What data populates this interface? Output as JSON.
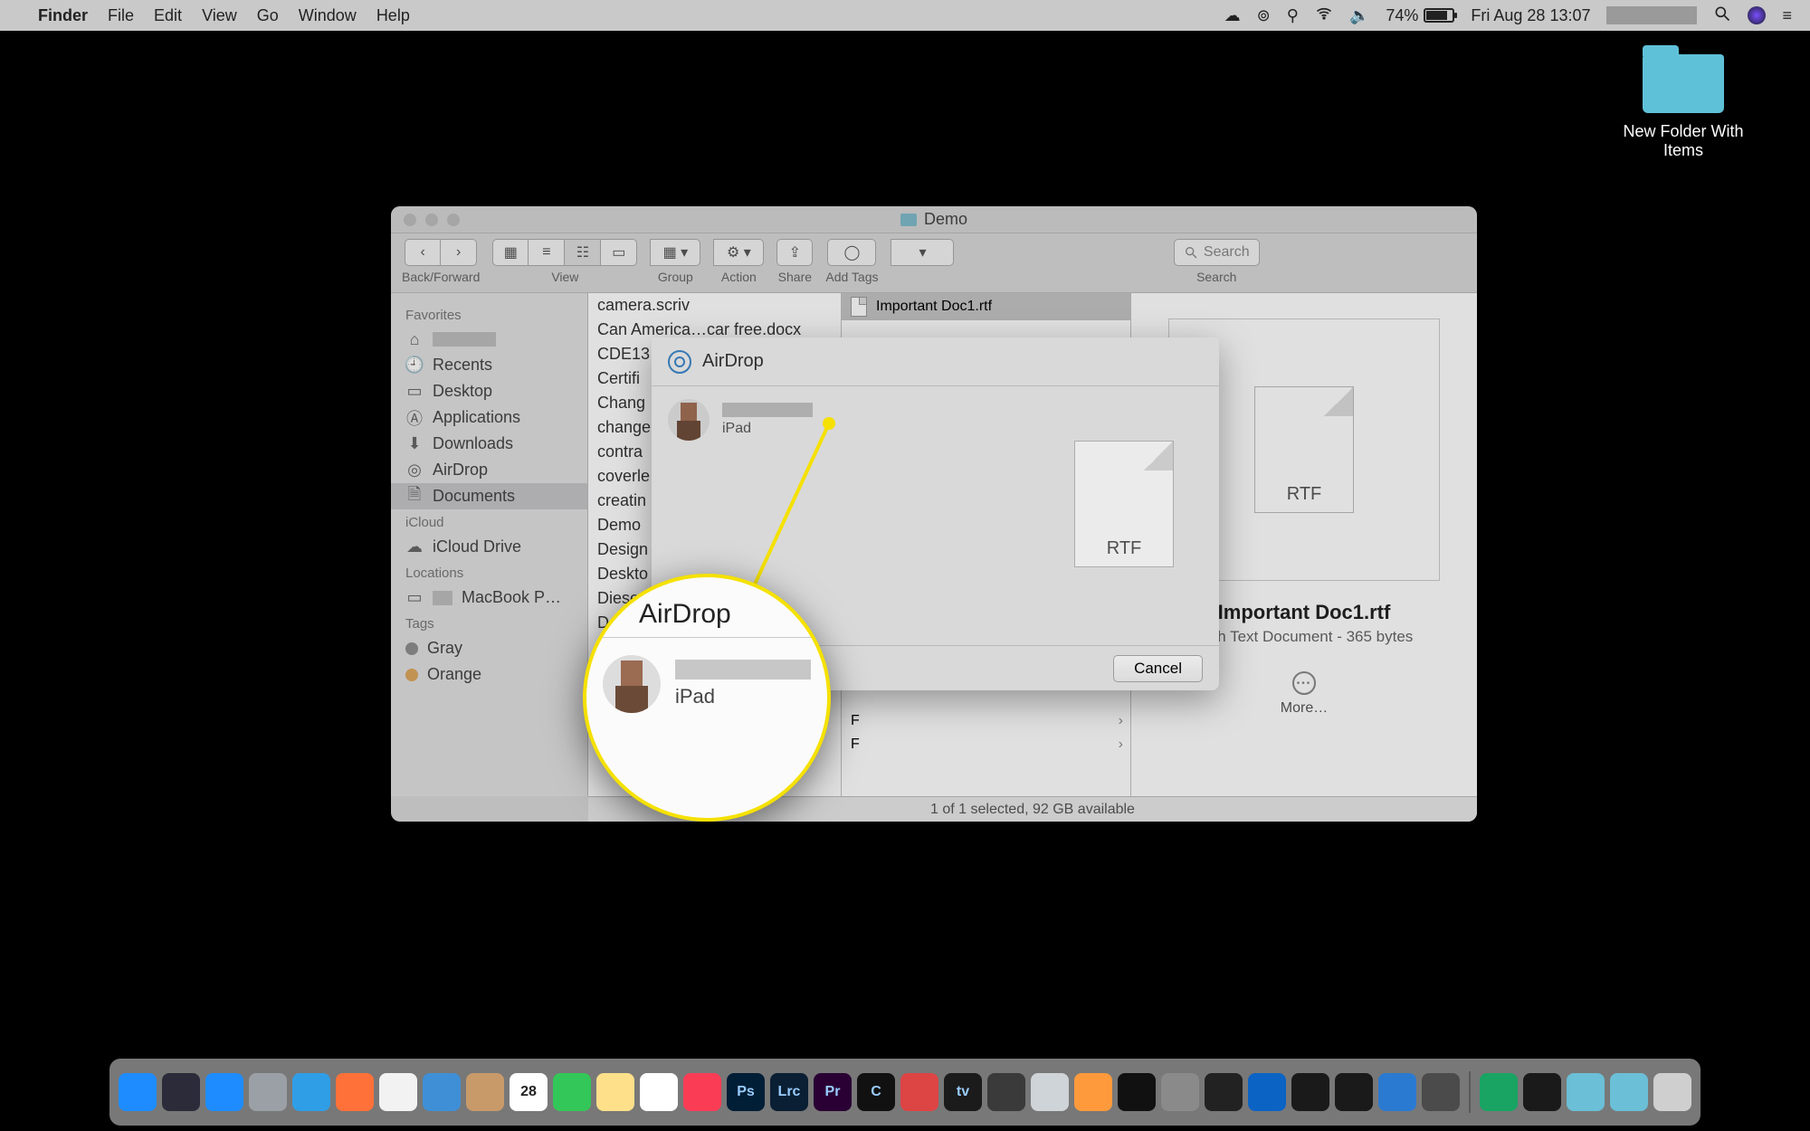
{
  "menubar": {
    "app_name": "Finder",
    "menus": [
      "File",
      "Edit",
      "View",
      "Go",
      "Window",
      "Help"
    ],
    "battery_pct": "74%",
    "clock": "Fri Aug 28  13:07"
  },
  "desktop_folder": {
    "label": "New Folder With Items"
  },
  "finder": {
    "title": "Demo",
    "toolbar": {
      "back_forward": "Back/Forward",
      "view": "View",
      "group": "Group",
      "action": "Action",
      "share": "Share",
      "tags": "Add Tags",
      "search_placeholder": "Search",
      "search_label": "Search"
    },
    "sidebar": {
      "favorites_label": "Favorites",
      "favorites": [
        "",
        "Recents",
        "Desktop",
        "Applications",
        "Downloads",
        "AirDrop",
        "Documents"
      ],
      "icloud_label": "iCloud",
      "icloud": [
        "iCloud Drive"
      ],
      "locations_label": "Locations",
      "locations": [
        "MacBook P…"
      ],
      "tags_label": "Tags",
      "tags": [
        {
          "name": "Gray",
          "color": "#8e8e8e"
        },
        {
          "name": "Orange",
          "color": "#f0a33a"
        }
      ]
    },
    "col_files": [
      "camera.scriv",
      "Can America…car free.docx",
      "CDE13",
      "Certifi",
      "Chang",
      "change",
      "contra",
      "coverle",
      "creatin",
      "Demo",
      "Design",
      "Deskto",
      "Diese",
      "D"
    ],
    "col_mid": {
      "selected": "Important Doc1.rtf",
      "folders": [
        "F",
        "F"
      ]
    },
    "preview": {
      "doc_ext": "RTF",
      "name": "Important Doc1.rtf",
      "meta": "Rich Text Document - 365 bytes",
      "more": "More…"
    },
    "status": "1 of 1 selected, 92 GB available"
  },
  "sheet": {
    "title": "AirDrop",
    "device_sub": "iPad",
    "doc_ext": "RTF",
    "cancel": "Cancel"
  },
  "zoom": {
    "title": "AirDrop",
    "sub": "iPad"
  },
  "dock": {
    "apps": [
      {
        "n": "finder",
        "c": "#1e8cff"
      },
      {
        "n": "siri",
        "c": "#2b2b3a"
      },
      {
        "n": "appstore",
        "c": "#1e8cff"
      },
      {
        "n": "launchpad",
        "c": "#9aa0a6"
      },
      {
        "n": "safari",
        "c": "#2f9ee6"
      },
      {
        "n": "firefox",
        "c": "#ff7139"
      },
      {
        "n": "chrome",
        "c": "#f2f2f2"
      },
      {
        "n": "mail",
        "c": "#3f8fd6"
      },
      {
        "n": "contacts",
        "c": "#c89a6a"
      },
      {
        "n": "calendar",
        "c": "#ffffff",
        "t": "28",
        "tc": "#222"
      },
      {
        "n": "messages",
        "c": "#33c759"
      },
      {
        "n": "notes",
        "c": "#ffe08a"
      },
      {
        "n": "reminders",
        "c": "#ffffff"
      },
      {
        "n": "music",
        "c": "#fa3c55"
      },
      {
        "n": "photoshop",
        "c": "#001e36",
        "t": "Ps"
      },
      {
        "n": "lightroom",
        "c": "#0a1f33",
        "t": "Lrc"
      },
      {
        "n": "premiere",
        "c": "#2a0034",
        "t": "Pr"
      },
      {
        "n": "capture",
        "c": "#111",
        "t": "C"
      },
      {
        "n": "app1",
        "c": "#d44"
      },
      {
        "n": "appletv",
        "c": "#1b1b1b",
        "t": "tv"
      },
      {
        "n": "quicktime",
        "c": "#3a3a3a"
      },
      {
        "n": "preview",
        "c": "#cfd4d8"
      },
      {
        "n": "pages",
        "c": "#ff9a3c"
      },
      {
        "n": "terminal",
        "c": "#111"
      },
      {
        "n": "systemprefs",
        "c": "#8a8a8a"
      },
      {
        "n": "app2",
        "c": "#222"
      },
      {
        "n": "onedrive",
        "c": "#0b63c4"
      },
      {
        "n": "nikon1",
        "c": "#1a1a1a"
      },
      {
        "n": "nikon2",
        "c": "#1a1a1a"
      },
      {
        "n": "vscode",
        "c": "#2b7ad1"
      },
      {
        "n": "sublime",
        "c": "#4b4b4b"
      }
    ],
    "right": [
      {
        "n": "app3",
        "c": "#19a463"
      },
      {
        "n": "1password",
        "c": "#1a1a1a"
      },
      {
        "n": "downloads",
        "c": "#6bbfd6"
      },
      {
        "n": "folder",
        "c": "#6bbfd6"
      },
      {
        "n": "trash",
        "c": "#cfcfcf"
      }
    ]
  }
}
